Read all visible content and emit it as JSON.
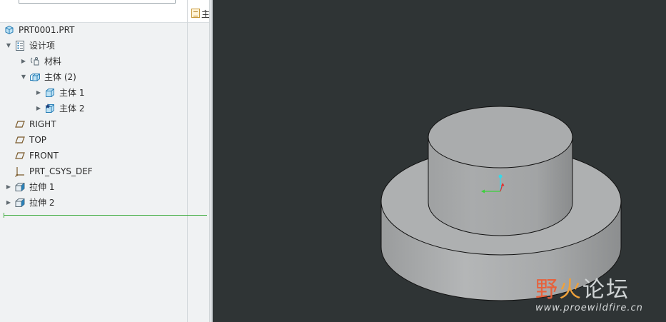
{
  "filter": {
    "label": "主"
  },
  "tree": {
    "root": "PRT0001.PRT",
    "design_items": "设计项",
    "material": "材料",
    "bodies": "主体 (2)",
    "body1": "主体 1",
    "body2": "主体 2",
    "right": "RIGHT",
    "top": "TOP",
    "front": "FRONT",
    "csys": "PRT_CSYS_DEF",
    "extrude1": "拉伸 1",
    "extrude2": "拉伸 2"
  },
  "watermark": {
    "part1": "野",
    "part2": "火",
    "part3": "论坛",
    "url": "www.proewildfire.cn"
  },
  "colors": {
    "viewport_bg": "#2f3435",
    "panel_bg": "#f0f2f3",
    "insert_line": "#3dab3d",
    "watermark_red": "#e8603a",
    "watermark_orange": "#f0a13a"
  }
}
